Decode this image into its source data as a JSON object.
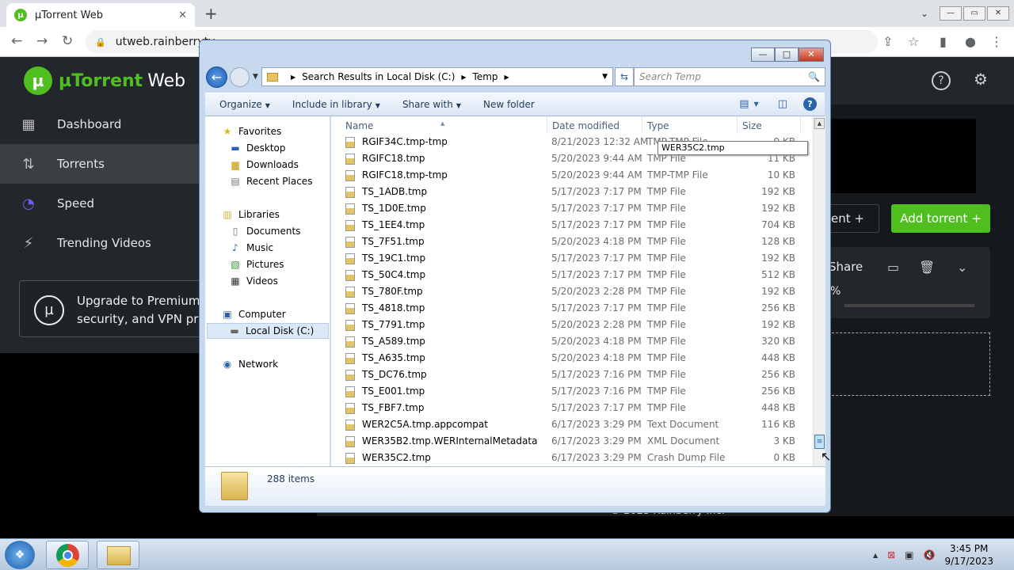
{
  "browser": {
    "tab_title": "µTorrent Web",
    "tab_favicon": "µ",
    "close_glyph": "✕",
    "new_tab": "+",
    "tab_search_glyph": "⌄",
    "url": "utweb.rainberrytv",
    "back_glyph": "←",
    "forward_glyph": "→",
    "reload_glyph": "↻",
    "lock_glyph": "🔒",
    "share_glyph": "⇪",
    "star_glyph": "☆",
    "sidepanel_glyph": "▮",
    "profile_glyph": "●",
    "menu_glyph": "⋮",
    "win_min": "—",
    "win_max": "▭",
    "win_close": "✕"
  },
  "utorrent": {
    "logo_glyph": "µ",
    "logo_text": "µTorrent",
    "logo_text2": "Web",
    "help_glyph": "?",
    "settings_glyph": "⚙",
    "sidebar": [
      {
        "label": "Dashboard",
        "icon": "▦"
      },
      {
        "label": "Torrents",
        "icon": "⇅"
      },
      {
        "label": "Speed",
        "icon": "◔"
      },
      {
        "label": "Trending Videos",
        "icon": "⚡"
      }
    ],
    "premium_icon": "µ",
    "premium_line1": "Upgrade to Premium: N",
    "premium_line2": "security, and VPN priva",
    "add_link_label": "ent  +",
    "add_torrent_label": "Add torrent  +",
    "share_label": "Share",
    "folder_glyph": "▭",
    "trash_glyph": "🗑",
    "chevron_glyph": "⌄",
    "percent_label": "%",
    "footer": "© 2023 Rainberry Inc."
  },
  "explorer": {
    "title_min": "—",
    "title_max": "□",
    "title_close": "✕",
    "back_glyph": "←",
    "history_glyph": "▼",
    "breadcrumb_1": "Search Results in Local Disk (C:)",
    "breadcrumb_2": "Temp",
    "sep_glyph": "▶",
    "dropdown_glyph": "▼",
    "refresh_glyph": "⇆",
    "search_placeholder": "Search Temp",
    "search_glyph": "🔍",
    "toolbar": {
      "organize": "Organize",
      "include": "Include in library",
      "share": "Share with",
      "new_folder": "New folder",
      "dd": "▼",
      "views_glyph": "▤",
      "views_dd": "▼",
      "preview_glyph": "◫",
      "help_glyph": "?"
    },
    "nav": {
      "favorites": "Favorites",
      "desktop": "Desktop",
      "downloads": "Downloads",
      "recent": "Recent Places",
      "libraries": "Libraries",
      "documents": "Documents",
      "music": "Music",
      "pictures": "Pictures",
      "videos": "Videos",
      "computer": "Computer",
      "local_disk": "Local Disk (C:)",
      "network": "Network",
      "star_glyph": "★",
      "desktop_glyph": "▬",
      "folder_glyph": "▆",
      "recent_glyph": "▤",
      "library_glyph": "▥",
      "doc_glyph": "▯",
      "music_glyph": "♪",
      "picture_glyph": "▧",
      "video_glyph": "▦",
      "computer_glyph": "▣",
      "disk_glyph": "▬",
      "network_glyph": "◉"
    },
    "columns": {
      "name": "Name",
      "date": "Date modified",
      "type": "Type",
      "size": "Size",
      "sort_glyph": "▲"
    },
    "rows": [
      {
        "name": "RGIF34C.tmp-tmp",
        "date": "8/21/2023 12:32 AM",
        "type": "TMP-TMP File",
        "size": "0 KB"
      },
      {
        "name": "RGIFC18.tmp",
        "date": "5/20/2023 9:44 AM",
        "type": "TMP File",
        "size": "11 KB"
      },
      {
        "name": "RGIFC18.tmp-tmp",
        "date": "5/20/2023 9:44 AM",
        "type": "TMP-TMP File",
        "size": "10 KB"
      },
      {
        "name": "TS_1ADB.tmp",
        "date": "5/17/2023 7:17 PM",
        "type": "TMP File",
        "size": "192 KB"
      },
      {
        "name": "TS_1D0E.tmp",
        "date": "5/17/2023 7:17 PM",
        "type": "TMP File",
        "size": "192 KB"
      },
      {
        "name": "TS_1EE4.tmp",
        "date": "5/17/2023 7:17 PM",
        "type": "TMP File",
        "size": "704 KB"
      },
      {
        "name": "TS_7F51.tmp",
        "date": "5/20/2023 4:18 PM",
        "type": "TMP File",
        "size": "128 KB"
      },
      {
        "name": "TS_19C1.tmp",
        "date": "5/17/2023 7:17 PM",
        "type": "TMP File",
        "size": "192 KB"
      },
      {
        "name": "TS_50C4.tmp",
        "date": "5/17/2023 7:17 PM",
        "type": "TMP File",
        "size": "512 KB"
      },
      {
        "name": "TS_780F.tmp",
        "date": "5/20/2023 2:28 PM",
        "type": "TMP File",
        "size": "192 KB"
      },
      {
        "name": "TS_4818.tmp",
        "date": "5/17/2023 7:17 PM",
        "type": "TMP File",
        "size": "256 KB"
      },
      {
        "name": "TS_7791.tmp",
        "date": "5/20/2023 2:28 PM",
        "type": "TMP File",
        "size": "192 KB"
      },
      {
        "name": "TS_A589.tmp",
        "date": "5/20/2023 4:18 PM",
        "type": "TMP File",
        "size": "320 KB"
      },
      {
        "name": "TS_A635.tmp",
        "date": "5/20/2023 4:18 PM",
        "type": "TMP File",
        "size": "448 KB"
      },
      {
        "name": "TS_DC76.tmp",
        "date": "5/17/2023 7:16 PM",
        "type": "TMP File",
        "size": "256 KB"
      },
      {
        "name": "TS_E001.tmp",
        "date": "5/17/2023 7:16 PM",
        "type": "TMP File",
        "size": "256 KB"
      },
      {
        "name": "TS_FBF7.tmp",
        "date": "5/17/2023 7:17 PM",
        "type": "TMP File",
        "size": "448 KB"
      },
      {
        "name": "WER2C5A.tmp.appcompat",
        "date": "6/17/2023 3:29 PM",
        "type": "Text Document",
        "size": "116 KB"
      },
      {
        "name": "WER35B2.tmp.WERInternalMetadata",
        "date": "6/17/2023 3:29 PM",
        "type": "XML Document",
        "size": "3 KB"
      },
      {
        "name": "WER35C2.tmp",
        "date": "6/17/2023 3:29 PM",
        "type": "Crash Dump File",
        "size": "0 KB"
      }
    ],
    "tooltip": "WER35C2.tmp",
    "scroll_up_glyph": "▲",
    "scroll_thumb_glyph": "≡",
    "cursor_glyph": "↖",
    "item_count": "288 items"
  },
  "taskbar": {
    "start_glyph": "❖",
    "tray_up": "▲",
    "tray_1": "⊠",
    "tray_2": "▣",
    "tray_3": "🔇",
    "time": "3:45 PM",
    "date": "9/17/2023"
  }
}
